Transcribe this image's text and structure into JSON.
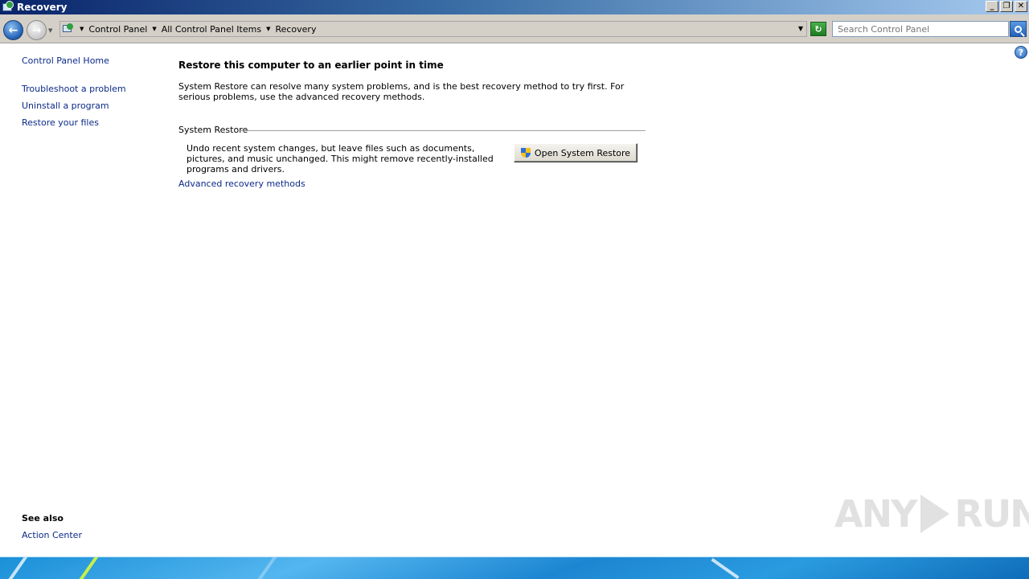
{
  "window": {
    "title": "Recovery",
    "buttons": {
      "minimize": "_",
      "restore": "❐",
      "close": "✕"
    }
  },
  "address": {
    "crumbs": [
      "Control Panel",
      "All Control Panel Items",
      "Recovery"
    ],
    "search_placeholder": "Search Control Panel"
  },
  "left_pane": {
    "home": "Control Panel Home",
    "links": [
      "Troubleshoot a problem",
      "Uninstall a program",
      "Restore your files"
    ],
    "see_also_title": "See also",
    "see_also_links": [
      "Action Center"
    ]
  },
  "main": {
    "title": "Restore this computer to an earlier point in time",
    "description": "System Restore can resolve many system problems, and is the best recovery method to try first. For serious problems, use the advanced recovery methods.",
    "section_title": "System Restore",
    "section_description": "Undo recent system changes, but leave files such as documents, pictures, and music unchanged. This might remove recently-installed programs and drivers.",
    "button_label": "Open System Restore",
    "advanced_link": "Advanced recovery methods"
  },
  "watermark": {
    "left": "ANY",
    "right": "RUN"
  },
  "icons": {
    "app": "control-panel-icon",
    "back": "back-arrow-icon",
    "forward": "forward-arrow-icon",
    "refresh": "refresh-icon",
    "search": "search-icon",
    "help": "help-icon",
    "shield": "uac-shield-icon"
  }
}
